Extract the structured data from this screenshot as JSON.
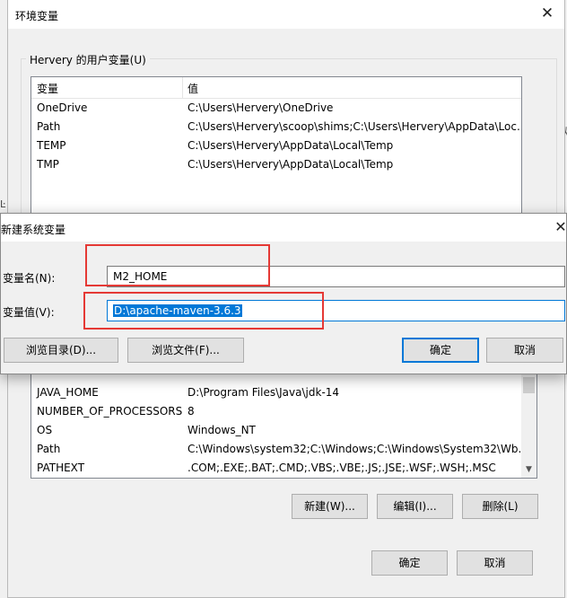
{
  "env_window": {
    "title": "环境变量",
    "user_vars": {
      "group_label": "Hervery 的用户变量(U)",
      "columns": [
        "变量",
        "值"
      ],
      "rows": [
        {
          "name": "OneDrive",
          "value": "C:\\Users\\Hervery\\OneDrive"
        },
        {
          "name": "Path",
          "value": "C:\\Users\\Hervery\\scoop\\shims;C:\\Users\\Hervery\\AppData\\Loc..."
        },
        {
          "name": "TEMP",
          "value": "C:\\Users\\Hervery\\AppData\\Local\\Temp"
        },
        {
          "name": "TMP",
          "value": "C:\\Users\\Hervery\\AppData\\Local\\Temp"
        }
      ]
    },
    "system_vars": {
      "rows": [
        {
          "name": "JAVA_HOME",
          "value": "D:\\Program Files\\Java\\jdk-14"
        },
        {
          "name": "NUMBER_OF_PROCESSORS",
          "value": "8"
        },
        {
          "name": "OS",
          "value": "Windows_NT"
        },
        {
          "name": "Path",
          "value": "C:\\Windows\\system32;C:\\Windows;C:\\Windows\\System32\\Wb..."
        },
        {
          "name": "PATHEXT",
          "value": ".COM;.EXE;.BAT;.CMD;.VBS;.VBE;.JS;.JSE;.WSF;.WSH;.MSC"
        }
      ],
      "buttons": {
        "new": "新建(W)...",
        "edit": "编辑(I)...",
        "delete": "删除(L)"
      }
    },
    "ok": "确定",
    "cancel": "取消"
  },
  "dialog": {
    "title": "新建系统变量",
    "name_label": "变量名(N):",
    "name_value": "M2_HOME",
    "value_label": "变量值(V):",
    "value_value": "D:\\apache-maven-3.6.3",
    "browse_dir": "浏览目录(D)...",
    "browse_file": "浏览文件(F)...",
    "ok": "确定",
    "cancel": "取消"
  },
  "background_fragments": {
    "right_char": "似",
    "left_char": "Ŀ"
  },
  "icons": {
    "close": "close-icon",
    "scroll_up": "chevron-up-icon",
    "scroll_down": "chevron-down-icon"
  },
  "colors": {
    "accent": "#0078d7",
    "annotation": "#e53935"
  }
}
